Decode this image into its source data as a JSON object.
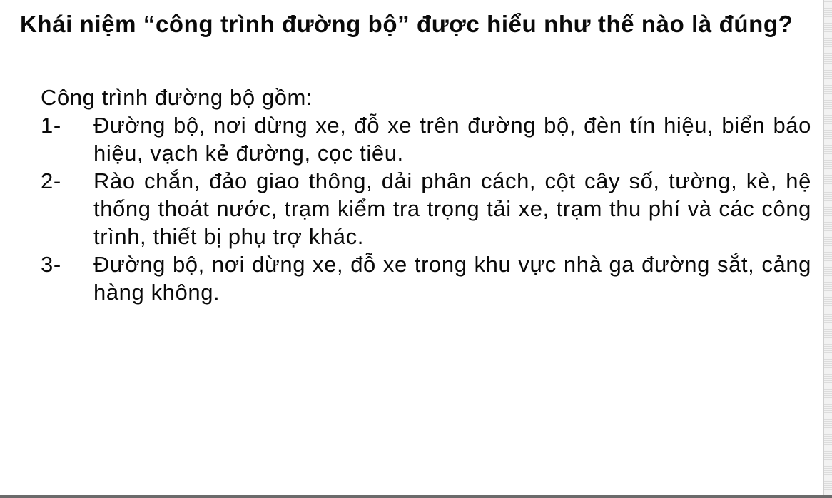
{
  "question": "Khái niệm “công trình đường bộ” được hiểu như thế nào là đúng?",
  "intro": "Công trình đường bộ gồm:",
  "options": [
    {
      "number": "1-",
      "text": "Đường bộ, nơi dừng xe, đỗ xe trên đường bộ, đèn tín hiệu, biển báo hiệu, vạch kẻ đường, cọc tiêu."
    },
    {
      "number": "2-",
      "text": "Rào chắn, đảo giao thông, dải phân cách, cột cây số, tường, kè, hệ thống thoát nước, trạm kiểm tra trọng tải xe, trạm thu phí và các công trình, thiết bị phụ trợ khác."
    },
    {
      "number": "3-",
      "text": "Đường bộ, nơi dừng xe, đỗ xe trong khu vực nhà ga đường sắt, cảng hàng không."
    }
  ]
}
